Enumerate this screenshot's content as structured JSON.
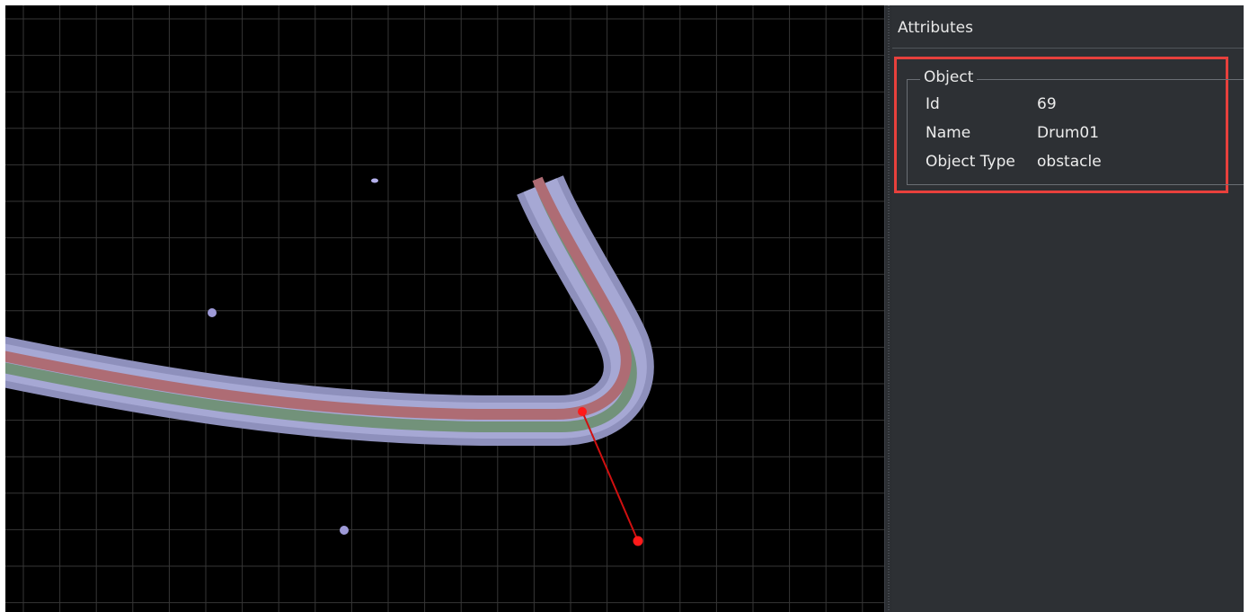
{
  "panel": {
    "title": "Attributes",
    "group_title": "Object",
    "rows": [
      {
        "key": "Id",
        "value": "69"
      },
      {
        "key": "Name",
        "value": "Drum01"
      },
      {
        "key": "Object Type",
        "value": "obstacle"
      }
    ]
  },
  "colors": {
    "viewport_background": "#000000",
    "grid": "#3a3a3a",
    "path_outer": "#9a9cc8",
    "path_inner_light": "#a8aad2",
    "path_green": "#74947a",
    "path_red": "#b06a72",
    "marker_red": "#ff1a1a",
    "dot": "#a4a0e0",
    "highlight_border": "#e8403c",
    "panel_background": "#2d3034"
  }
}
